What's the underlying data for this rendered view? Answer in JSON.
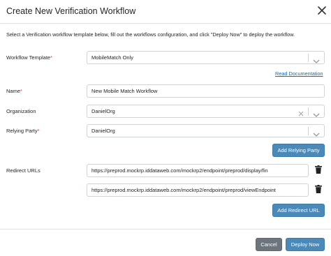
{
  "modal": {
    "title": "Create New Verification Workflow",
    "intro": "Select a Verification workflow template below, fill out the workflows configuration, and click \"Deploy Now\" to deploy the workflow."
  },
  "form": {
    "template": {
      "label": "Workflow Template",
      "required_mark": "*",
      "value": "MobileMatch Only"
    },
    "read_docs": "Read Documentation",
    "name": {
      "label": "Name",
      "required_mark": "*",
      "value": "New Mobile Match Workflow"
    },
    "organization": {
      "label": "Organization",
      "value": "DanielOrg"
    },
    "relying_party": {
      "label": "Relying Party",
      "required_mark": "*",
      "value": "DanielOrg"
    },
    "add_relying_party": "Add Relying Party",
    "redirect_urls": {
      "label": "Redirect URLs",
      "items": [
        "https://preprod.mockrp.iddataweb.com/mockrp2/endpoint/preprod/display/fin",
        "https://preprod.mockrp.iddataweb.com/mockrp2/endpoint/preprod/viewEndpoint"
      ],
      "add_label": "Add Redirect URL"
    }
  },
  "footer": {
    "cancel": "Cancel",
    "deploy": "Deploy Now"
  },
  "icons": {
    "close": "close-icon",
    "chevron": "chevron-down-icon",
    "clear": "clear-x-icon",
    "trash": "trash-icon"
  },
  "colors": {
    "primary": "#4a89b8",
    "secondary": "#6c757d",
    "link": "#0d6ebd",
    "required": "#dc3545"
  }
}
